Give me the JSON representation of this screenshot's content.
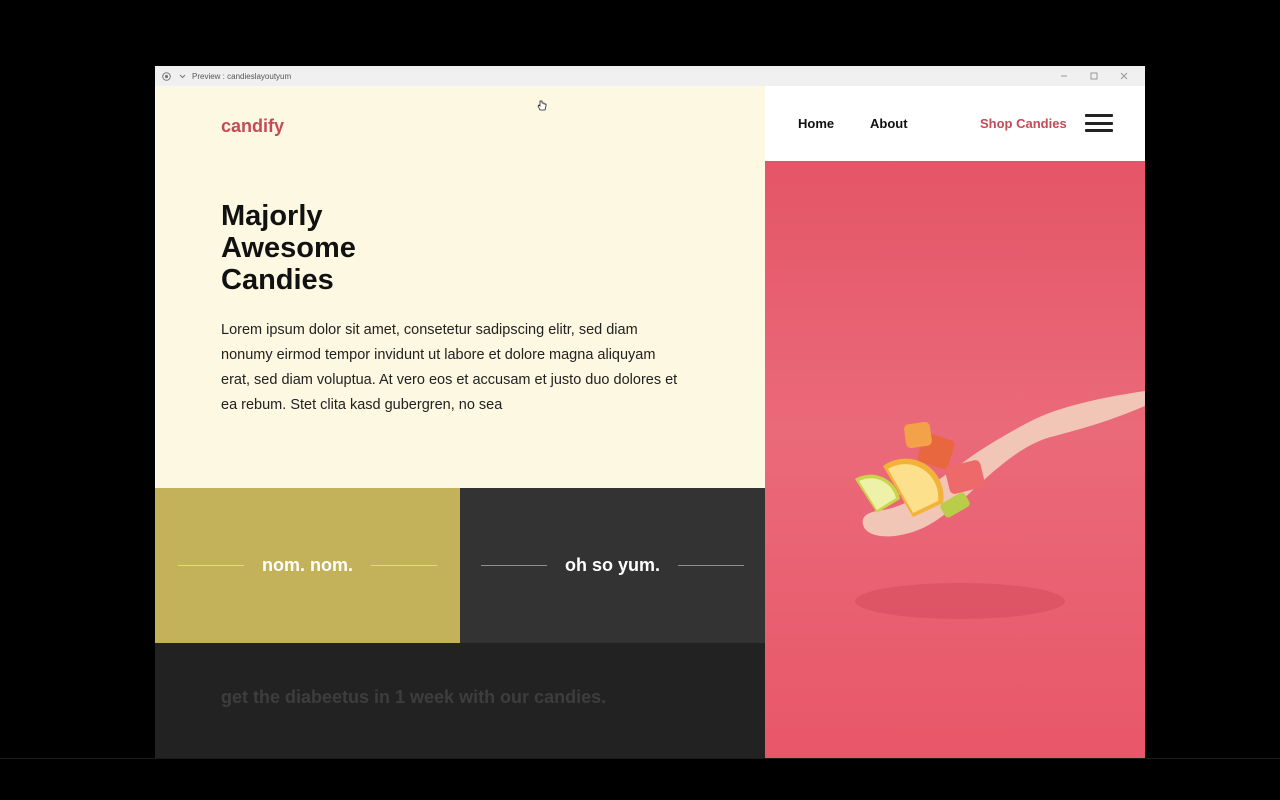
{
  "window": {
    "title": "Preview : candieslayoutyum"
  },
  "brand": {
    "logo": "candify",
    "accent": "#c44a55"
  },
  "hero": {
    "headline_lines": [
      "Majorly",
      "Awesome",
      "Candies"
    ],
    "body": "Lorem ipsum dolor sit amet, consetetur sadipscing elitr, sed diam nonumy eirmod tempor invidunt ut labore et dolore magna aliquyam erat, sed diam voluptua. At vero eos et accusam et justo duo dolores et ea rebum. Stet clita kasd gubergren, no sea"
  },
  "tiles": [
    {
      "label": "nom. nom.",
      "color": "#c3b25a"
    },
    {
      "label": "oh so yum.",
      "color": "#333333"
    }
  ],
  "footer": {
    "tagline": "get the diabeetus in 1 week with our candies."
  },
  "nav": {
    "home": "Home",
    "about": "About",
    "shop": "Shop Candies",
    "menu_icon": "hamburger-menu-icon"
  },
  "colors": {
    "hero_bg": "#fdf8e1",
    "photo_bg": "#e45567",
    "footer_bg": "#222222"
  }
}
